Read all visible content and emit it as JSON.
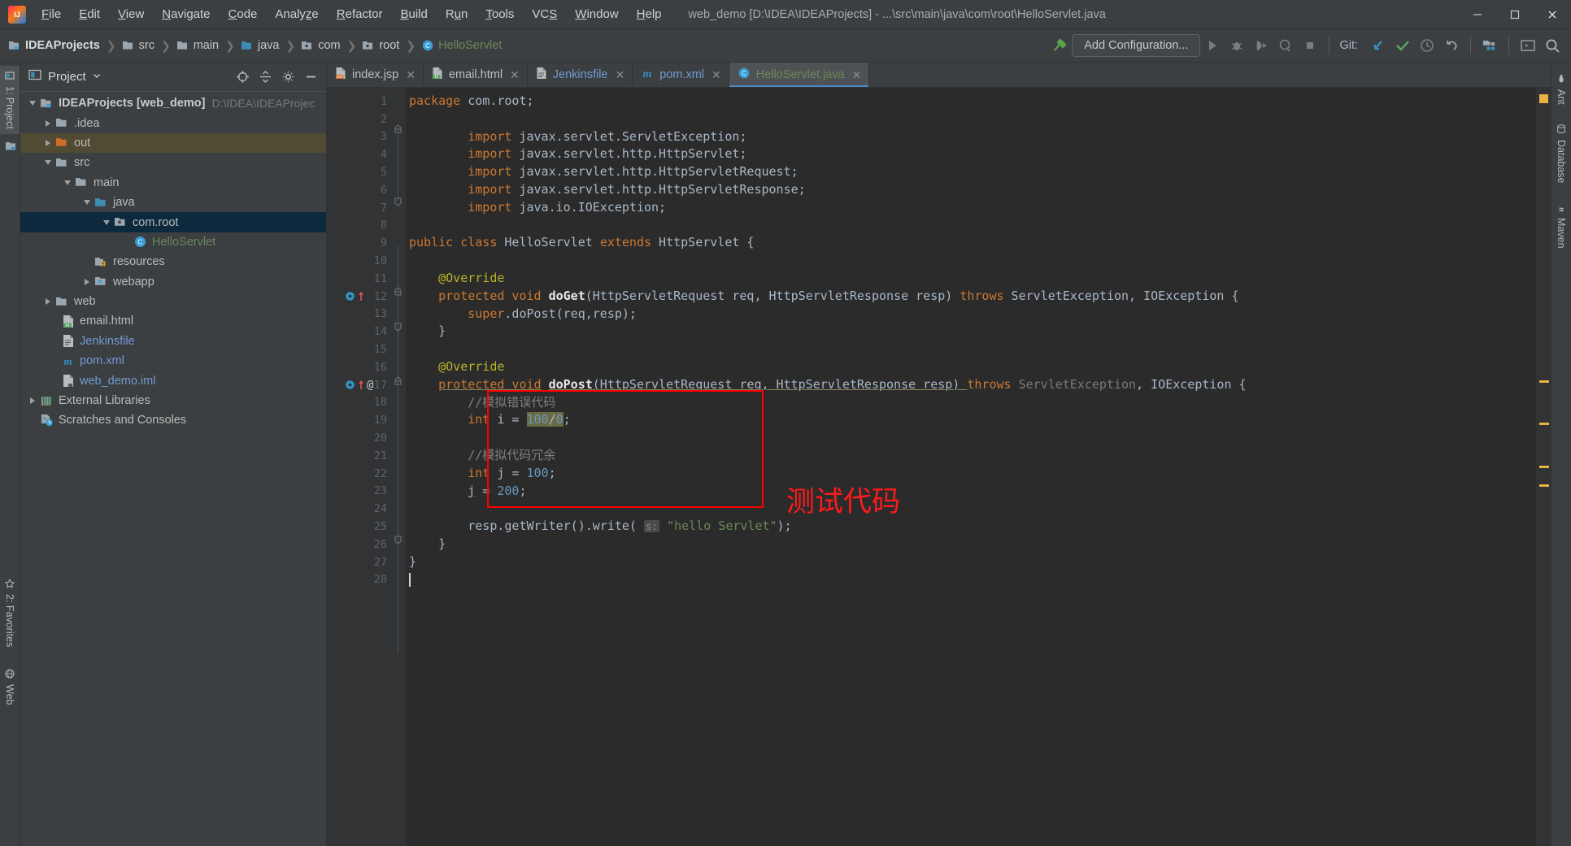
{
  "window": {
    "title": "web_demo [D:\\IDEA\\IDEAProjects] - ...\\src\\main\\java\\com\\root\\HelloServlet.java",
    "minimize": "—",
    "maximize": "▢",
    "close": "✕"
  },
  "menubar": {
    "items": [
      {
        "label": "File"
      },
      {
        "label": "Edit"
      },
      {
        "label": "View"
      },
      {
        "label": "Navigate"
      },
      {
        "label": "Code"
      },
      {
        "label": "Analyze"
      },
      {
        "label": "Refactor"
      },
      {
        "label": "Build"
      },
      {
        "label": "Run"
      },
      {
        "label": "Tools"
      },
      {
        "label": "VCS"
      },
      {
        "label": "Window"
      },
      {
        "label": "Help"
      }
    ]
  },
  "breadcrumbs": [
    {
      "label": "IDEAProjects",
      "icon": "project-folder-icon",
      "style": "bold"
    },
    {
      "label": "src",
      "icon": "folder-icon",
      "style": "normal"
    },
    {
      "label": "main",
      "icon": "folder-icon",
      "style": "normal"
    },
    {
      "label": "java",
      "icon": "source-folder-icon",
      "style": "normal"
    },
    {
      "label": "com",
      "icon": "package-icon",
      "style": "normal"
    },
    {
      "label": "root",
      "icon": "package-icon",
      "style": "normal"
    },
    {
      "label": "HelloServlet",
      "icon": "class-icon",
      "style": "green"
    }
  ],
  "toolbar": {
    "add_configuration": "Add Configuration...",
    "git_label": "Git:",
    "run_icon": "run-icon",
    "debug_icon": "debug-icon",
    "run_coverage_icon": "run-with-coverage-icon",
    "profile_icon": "profiler-icon",
    "stop_icon": "stop-icon",
    "build_icon": "build-hammer-icon",
    "update_icon": "git-update-project-icon",
    "commit_icon": "git-commit-icon",
    "history_icon": "git-history-icon",
    "rollback_icon": "git-rollback-icon",
    "project_structure_icon": "project-structure-icon",
    "terminal_icon": "terminal-icon",
    "search_icon": "search-everywhere-icon"
  },
  "left_rail": {
    "tabs": [
      {
        "label": "1: Project",
        "icon": "project-tool-icon",
        "active": true
      },
      {
        "label": "2: Favorites",
        "icon": "favorites-icon",
        "active": false
      },
      {
        "label": "Web",
        "icon": "web-icon",
        "active": false
      }
    ]
  },
  "right_rail": {
    "tabs": [
      {
        "label": "Ant",
        "icon": "ant-icon"
      },
      {
        "label": "Database",
        "icon": "database-icon"
      },
      {
        "label": "Maven",
        "icon": "maven-icon"
      }
    ]
  },
  "project_panel": {
    "title": "Project",
    "dropdown_icon": "chevron-down-icon",
    "actions": [
      {
        "name": "select-opened-file-icon",
        "label": "⊕"
      },
      {
        "name": "collapse-all-icon",
        "label": "⇅"
      },
      {
        "name": "settings-gear-icon",
        "label": "⚙"
      },
      {
        "name": "hide-panel-icon",
        "label": "—"
      }
    ],
    "tree": [
      {
        "depth": 0,
        "twisty": "down",
        "icon": "project-root-icon",
        "label": "IDEAProjects [web_demo]",
        "sub": "D:\\IDEA\\IDEAProjec",
        "style": "bold",
        "state": "normal"
      },
      {
        "depth": 1,
        "twisty": "right",
        "icon": "folder-icon",
        "label": ".idea",
        "sub": "",
        "style": "normal",
        "state": "normal"
      },
      {
        "depth": 1,
        "twisty": "right",
        "icon": "folder-orange-icon",
        "label": "out",
        "sub": "",
        "style": "normal",
        "state": "marked"
      },
      {
        "depth": 1,
        "twisty": "down",
        "icon": "folder-icon",
        "label": "src",
        "sub": "",
        "style": "normal",
        "state": "normal"
      },
      {
        "depth": 2,
        "twisty": "down",
        "icon": "folder-icon",
        "label": "main",
        "sub": "",
        "style": "normal",
        "state": "normal"
      },
      {
        "depth": 3,
        "twisty": "down",
        "icon": "source-folder-icon",
        "label": "java",
        "sub": "",
        "style": "normal",
        "state": "normal"
      },
      {
        "depth": 4,
        "twisty": "down",
        "icon": "package-icon",
        "label": "com.root",
        "sub": "",
        "style": "normal",
        "state": "selected"
      },
      {
        "depth": 5,
        "twisty": "none",
        "icon": "class-icon",
        "label": "HelloServlet",
        "sub": "",
        "style": "green",
        "state": "normal"
      },
      {
        "depth": 3,
        "twisty": "none",
        "icon": "resources-folder-icon",
        "label": "resources",
        "sub": "",
        "style": "normal",
        "state": "normal"
      },
      {
        "depth": 3,
        "twisty": "right",
        "icon": "webapp-folder-icon",
        "label": "webapp",
        "sub": "",
        "style": "normal",
        "state": "normal"
      },
      {
        "depth": 1,
        "twisty": "right",
        "icon": "folder-icon",
        "label": "web",
        "sub": "",
        "style": "normal",
        "state": "normal"
      },
      {
        "depth": 2,
        "twisty": "none",
        "icon": "html-file-icon",
        "label": "email.html",
        "sub": "",
        "style": "normal",
        "state": "normal"
      },
      {
        "depth": 2,
        "twisty": "none",
        "icon": "text-file-icon",
        "label": "Jenkinsfile",
        "sub": "",
        "style": "blue",
        "state": "normal"
      },
      {
        "depth": 2,
        "twisty": "none",
        "icon": "maven-pom-icon",
        "label": "pom.xml",
        "sub": "",
        "style": "blue",
        "state": "normal"
      },
      {
        "depth": 2,
        "twisty": "none",
        "icon": "iml-file-icon",
        "label": "web_demo.iml",
        "sub": "",
        "style": "blue",
        "state": "normal"
      },
      {
        "depth": 0,
        "twisty": "right",
        "icon": "external-libraries-icon",
        "label": "External Libraries",
        "sub": "",
        "style": "normal",
        "state": "normal"
      },
      {
        "depth": 0,
        "twisty": "none",
        "icon": "scratches-icon",
        "label": "Scratches and Consoles",
        "sub": "",
        "style": "normal",
        "state": "normal"
      }
    ]
  },
  "editor": {
    "tabs": [
      {
        "label": "index.jsp",
        "icon": "jsp-file-icon",
        "style": "normal",
        "active": false,
        "close": "✕"
      },
      {
        "label": "email.html",
        "icon": "html-file-icon",
        "style": "normal",
        "active": false,
        "close": "✕"
      },
      {
        "label": "Jenkinsfile",
        "icon": "text-file-icon",
        "style": "blue",
        "active": false,
        "close": "✕"
      },
      {
        "label": "pom.xml",
        "icon": "maven-pom-icon",
        "style": "blue",
        "active": false,
        "close": "✕"
      },
      {
        "label": "HelloServlet.java",
        "icon": "class-icon",
        "style": "green",
        "active": true,
        "close": "✕"
      }
    ],
    "line_numbers": [
      1,
      2,
      3,
      4,
      5,
      6,
      7,
      8,
      9,
      10,
      11,
      12,
      13,
      14,
      15,
      16,
      17,
      18,
      19,
      20,
      21,
      22,
      23,
      24,
      25,
      26,
      27,
      28
    ],
    "gutter_marks": [
      {
        "line": 12,
        "icons": [
          "override-method-icon",
          "implementing-arrow-icon"
        ]
      },
      {
        "line": 17,
        "icons": [
          "override-method-icon",
          "implementing-arrow-icon",
          "annotation-at-icon"
        ]
      }
    ],
    "code_lines": [
      "package com.root;",
      "",
      "        import javax.servlet.ServletException;",
      "        import javax.servlet.http.HttpServlet;",
      "        import javax.servlet.http.HttpServletRequest;",
      "        import javax.servlet.http.HttpServletResponse;",
      "        import java.io.IOException;",
      "",
      "public class HelloServlet extends HttpServlet {",
      "",
      "    @Override",
      "    protected void doGet(HttpServletRequest req, HttpServletResponse resp) throws ServletException, IOException {",
      "        super.doPost(req,resp);",
      "    }",
      "",
      "    @Override",
      "    protected void doPost(HttpServletRequest req, HttpServletResponse resp) throws ServletException, IOException {",
      "        //模拟错误代码",
      "        int i = 100/0;",
      "",
      "        //模拟代码冗余",
      "        int j = 100;",
      "        j = 200;",
      "",
      "        resp.getWriter().write( s: \"hello Servlet\");",
      "    }",
      "}",
      ""
    ],
    "parameter_hint": "s:",
    "annotation": {
      "text": "测试代码",
      "color": "#ff1a1a",
      "box_color": "#ff0000"
    }
  }
}
